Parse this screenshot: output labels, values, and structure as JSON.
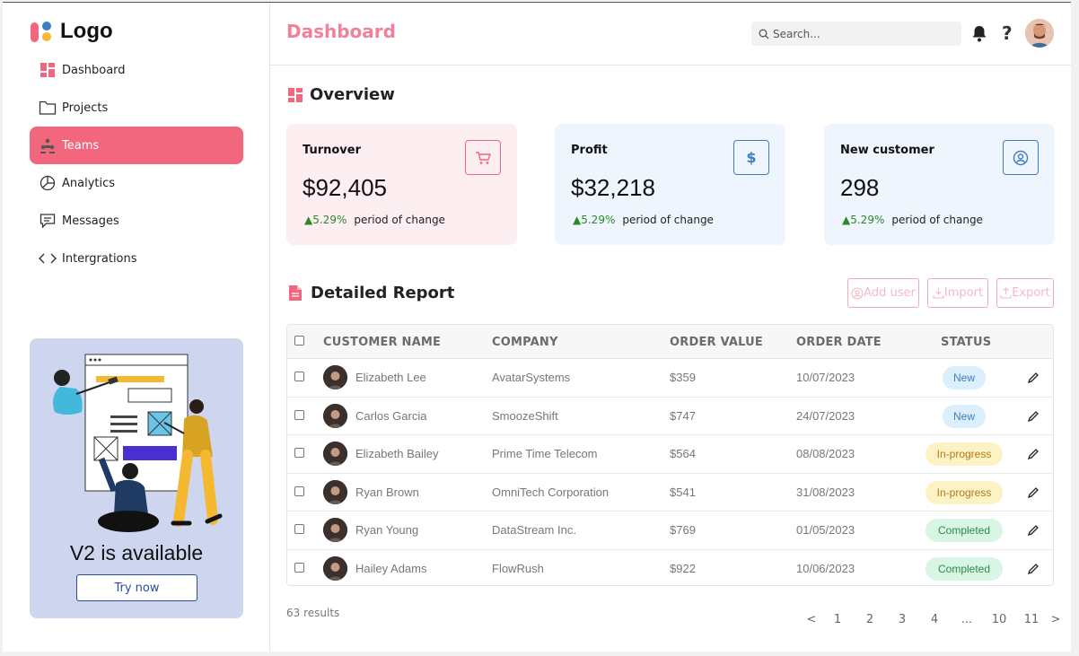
{
  "logo": {
    "text": "Logo"
  },
  "nav": [
    {
      "label": "Dashboard",
      "icon": "dashboard-icon"
    },
    {
      "label": "Projects",
      "icon": "folder-icon"
    },
    {
      "label": "Teams",
      "icon": "teams-icon",
      "active": true
    },
    {
      "label": "Analytics",
      "icon": "pie-chart-icon"
    },
    {
      "label": "Messages",
      "icon": "message-icon"
    },
    {
      "label": "Intergrations",
      "icon": "code-icon"
    }
  ],
  "promo": {
    "title": "V2 is available",
    "button": "Try now"
  },
  "header": {
    "title": "Dashboard",
    "search_placeholder": "Search..."
  },
  "overview": {
    "title": "Overview",
    "cards": [
      {
        "label": "Turnover",
        "value": "$92,405",
        "change": "5.29%",
        "change_text": "period of change",
        "icon": "cart-icon",
        "bg": "#fdeef2",
        "accent": "#f2667e"
      },
      {
        "label": "Profit",
        "value": "$32,218",
        "change": "5.29%",
        "change_text": "period of change",
        "icon": "dollar-icon",
        "bg": "#eef5fd",
        "accent": "#3d7fc2"
      },
      {
        "label": "New customer",
        "value": "298",
        "change": "5.29%",
        "change_text": "period of change",
        "icon": "user-circle-icon",
        "bg": "#eef5fd",
        "accent": "#3d7fc2"
      }
    ]
  },
  "report": {
    "title": "Detailed Report",
    "buttons": {
      "add_user": "Add user",
      "import": "Import",
      "export": "Export"
    },
    "columns": [
      "CUSTOMER NAME",
      "COMPANY",
      "ORDER VALUE",
      "ORDER DATE",
      "STATUS"
    ],
    "rows": [
      {
        "name": "Elizabeth Lee",
        "company": "AvatarSystems",
        "value": "$359",
        "date": "10/07/2023",
        "status": "New"
      },
      {
        "name": "Carlos Garcia",
        "company": "SmoozeShift",
        "value": "$747",
        "date": "24/07/2023",
        "status": "New"
      },
      {
        "name": "Elizabeth Bailey",
        "company": "Prime Time Telecom",
        "value": "$564",
        "date": "08/08/2023",
        "status": "In-progress"
      },
      {
        "name": "Ryan Brown",
        "company": "OmniTech Corporation",
        "value": "$541",
        "date": "31/08/2023",
        "status": "In-progress"
      },
      {
        "name": "Ryan Young",
        "company": "DataStream Inc.",
        "value": "$769",
        "date": "01/05/2023",
        "status": "Completed"
      },
      {
        "name": "Hailey Adams",
        "company": "FlowRush",
        "value": "$922",
        "date": "10/06/2023",
        "status": "Completed"
      }
    ],
    "results": "63 results",
    "pagination": [
      "<",
      "1",
      "2",
      "3",
      "4",
      "...",
      "10",
      "11",
      ">"
    ]
  }
}
